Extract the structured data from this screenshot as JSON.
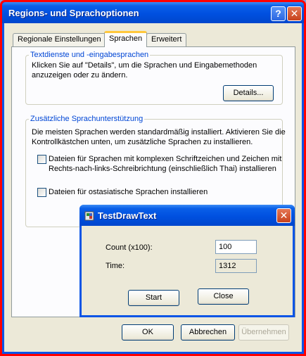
{
  "window": {
    "title": "Regions- und Sprachoptionen",
    "help": "?",
    "close": "✕"
  },
  "tabs": [
    {
      "label": "Regionale Einstellungen"
    },
    {
      "label": "Sprachen"
    },
    {
      "label": "Erweitert"
    }
  ],
  "text_services": {
    "legend": "Textdienste und -eingabesprachen",
    "line1": "Klicken Sie auf \"Details\", um die Sprachen und Eingabemethoden",
    "line2": "anzuzeigen oder zu ändern.",
    "details_button": "Details..."
  },
  "additional": {
    "legend": "Zusätzliche Sprachunterstützung",
    "line1": "Die meisten Sprachen werden standardmäßig installiert. Aktivieren Sie die",
    "line2": "Kontrollkästchen unten, um zusätzliche Sprachen zu installieren.",
    "complex_line1": "Dateien für Sprachen mit komplexen Schriftzeichen und Zeichen mit",
    "complex_line2": "Rechts-nach-links-Schreibrichtung (einschließlich Thai) installieren",
    "complex_checked": false,
    "eastasian_label": "Dateien für ostasiatische Sprachen installieren",
    "eastasian_checked": false
  },
  "footer": {
    "ok": "OK",
    "cancel": "Abbrechen",
    "apply": "Übernehmen"
  },
  "test_dialog": {
    "title": "TestDrawText",
    "close": "✕",
    "count_label": "Count (x100):",
    "count_value": "100",
    "time_label": "Time:",
    "time_value": "1312",
    "start_button": "Start",
    "close_button": "Close"
  }
}
